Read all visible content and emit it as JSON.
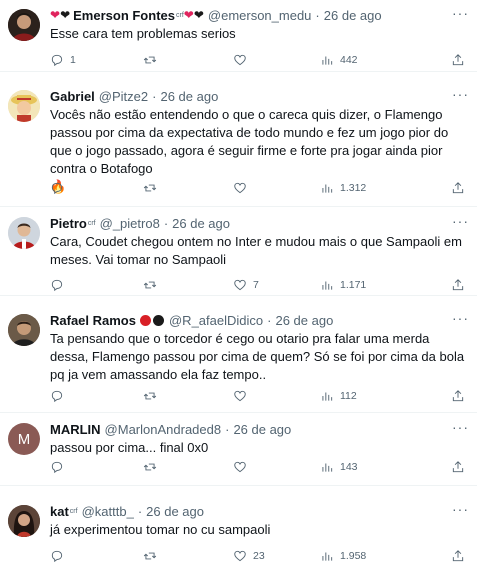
{
  "tweets": [
    {
      "name": "Emerson Fontes",
      "handle": "@emerson_medu",
      "time": "26 de ago",
      "badge_suffix": "crf",
      "text": "Esse cara tem problemas serios",
      "replies": "1",
      "retweets": "",
      "likes": "",
      "views": "442"
    },
    {
      "name": "Gabriel",
      "handle": "@Pitze2",
      "time": "26 de ago",
      "text": "Vocês não estão entendendo o que o careca quis dizer, o Flamengo passou por cima da expectativa de todo mundo e fez um jogo pior do que o jogo passado, agora é seguir firme e forte pra jogar ainda pior contra o Botafogo",
      "replies": "",
      "retweets": "",
      "likes": "",
      "views": "1.312"
    },
    {
      "name": "Pietro",
      "badge_suffix": "crf",
      "handle": "@_pietro8",
      "time": "26 de ago",
      "text": "Cara, Coudet chegou ontem no Inter e mudou mais o que Sampaoli em meses. Vai tomar no Sampaoli",
      "replies": "",
      "retweets": "",
      "likes": "7",
      "views": "1.171"
    },
    {
      "name": "Rafael Ramos",
      "handle": "@R_afaelDidico",
      "time": "26 de ago",
      "text": "Ta pensando que o torcedor é cego ou otario pra falar uma merda dessa, Flamengo passou por cima de quem? Só se foi por cima da bola pq ja vem amassando ela faz tempo..",
      "replies": "",
      "retweets": "",
      "likes": "",
      "views": "112"
    },
    {
      "name": "MARLIN",
      "handle": "@MarlonAndraded8",
      "time": "26 de ago",
      "avatar_letter": "M",
      "text": "passou por cima... final 0x0",
      "replies": "",
      "retweets": "",
      "likes": "",
      "views": "143"
    },
    {
      "name": "kat",
      "badge_suffix": "crf",
      "handle": "@katttb_",
      "time": "26 de ago",
      "text": "já experimentou tomar no cu sampaoli",
      "replies": "",
      "retweets": "",
      "likes": "23",
      "views": "1.958"
    }
  ],
  "separator": "·",
  "more_glyph": "···",
  "colors": {
    "text": "#0f1419",
    "muted": "#536471",
    "divider": "#eff3f4",
    "marlin_avatar": "#8a5a55"
  },
  "icons": [
    "reply-icon",
    "retweet-icon",
    "like-icon",
    "views-icon",
    "share-icon",
    "more-icon"
  ]
}
